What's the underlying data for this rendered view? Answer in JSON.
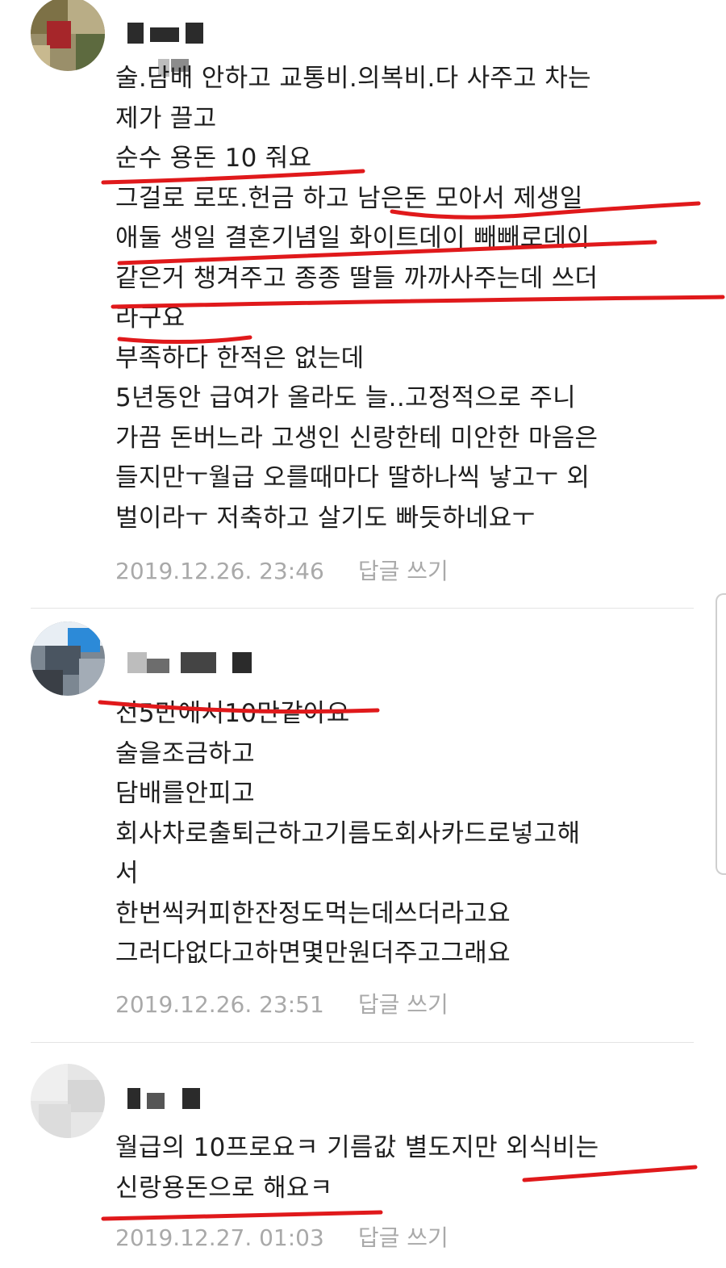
{
  "comments": [
    {
      "lines": [
        "술.담배 안하고 교통비.의복비.다 사주고 차는",
        "제가 끌고",
        "순수 용돈 10 줘요",
        "그걸로 로또.헌금 하고 남은돈 모아서 제생일",
        "애둘 생일 결혼기념일 화이트데이 빼빼로데이",
        "같은거 챙겨주고 종종 딸들 까까사주는데 쓰더",
        "라구요",
        "부족하다 한적은 없는데",
        "5년동안 급여가 올라도 늘..고정적으로 주니",
        "가끔 돈버느라 고생인 신랑한테 미안한 마음은",
        "들지만ㅜ월급 오를때마다 딸하나씩 낳고ㅜ 외",
        "벌이라ㅜ 저축하고 살기도 빠듯하네요ㅜ"
      ],
      "timestamp": "2019.12.26. 23:46",
      "reply_label": "답글 쓰기"
    },
    {
      "lines": [
        "전5만에서10만같아요",
        "술을조금하고",
        "담배를안피고",
        "회사차로출퇴근하고기름도회사카드로넣고해",
        "서",
        "한번씩커피한잔정도먹는데쓰더라고요",
        "그러다없다고하면몇만원더주고그래요"
      ],
      "timestamp": "2019.12.26. 23:51",
      "reply_label": "답글 쓰기"
    },
    {
      "lines": [
        "월급의 10프로요ㅋ 기름값 별도지만 외식비는",
        "신랑용돈으로 해요ㅋ"
      ],
      "timestamp": "2019.12.27. 01:03",
      "reply_label": "답글 쓰기"
    }
  ],
  "colors": {
    "annotation_red": "#e0191b",
    "meta_gray": "#a9a9a9",
    "divider": "#e4e4e4"
  }
}
